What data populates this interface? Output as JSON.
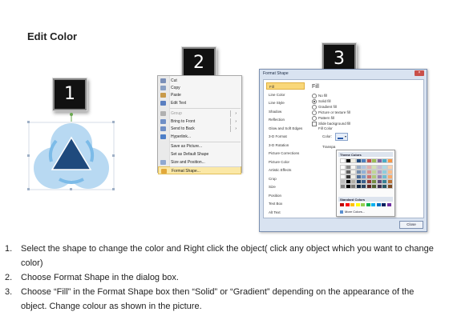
{
  "title": "Edit Color",
  "badges": [
    "1",
    "2",
    "3"
  ],
  "context_menu": {
    "items": [
      {
        "label": "Cut",
        "dim": false,
        "icon": "scissors-icon",
        "color": "#7a8fb8",
        "arrow": false
      },
      {
        "label": "Copy",
        "dim": false,
        "icon": "copy-icon",
        "color": "#8aa0c4",
        "arrow": false
      },
      {
        "label": "Paste",
        "dim": false,
        "icon": "paste-icon",
        "color": "#c89a4a",
        "arrow": false
      },
      {
        "label": "Edit Text",
        "dim": false,
        "icon": "edit-text-icon",
        "color": "#5a7fc0",
        "arrow": false
      },
      {
        "label": "Group",
        "dim": true,
        "icon": "group-icon",
        "color": "#b0b0b0",
        "arrow": true
      },
      {
        "label": "Bring to Front",
        "dim": false,
        "icon": "bring-front-icon",
        "color": "#6f8fc6",
        "arrow": true
      },
      {
        "label": "Send to Back",
        "dim": false,
        "icon": "send-back-icon",
        "color": "#6f8fc6",
        "arrow": true
      },
      {
        "label": "Hyperlink...",
        "dim": false,
        "icon": "hyperlink-icon",
        "color": "#4d7fc8",
        "arrow": false
      },
      {
        "label": "Save as Picture...",
        "dim": false,
        "icon": "",
        "color": "",
        "arrow": false
      },
      {
        "label": "Set as Default Shape",
        "dim": false,
        "icon": "",
        "color": "",
        "arrow": false
      },
      {
        "label": "Size and Position...",
        "dim": false,
        "icon": "size-icon",
        "color": "#8fa8d0",
        "arrow": false
      },
      {
        "label": "Format Shape...",
        "dim": false,
        "icon": "format-shape-icon",
        "color": "#e2a83a",
        "arrow": false
      }
    ]
  },
  "dialog": {
    "title": "Format Shape",
    "nav": [
      "Fill",
      "Line Color",
      "Line Style",
      "Shadow",
      "Reflection",
      "Glow and Soft Edges",
      "3-D Format",
      "3-D Rotation",
      "Picture Corrections",
      "Picture Color",
      "Artistic Effects",
      "Crop",
      "Size",
      "Position",
      "Text Box",
      "Alt Text"
    ],
    "fill_heading": "Fill",
    "options": [
      {
        "label": "No fill",
        "type": "radio",
        "on": false
      },
      {
        "label": "Solid fill",
        "type": "radio",
        "on": true
      },
      {
        "label": "Gradient fill",
        "type": "radio",
        "on": false
      },
      {
        "label": "Picture or texture fill",
        "type": "radio",
        "on": false
      },
      {
        "label": "Pattern fill",
        "type": "radio",
        "on": false
      },
      {
        "label": "Slide background fill",
        "type": "check",
        "on": false
      }
    ],
    "fill_color_label": "Fill Color",
    "color_label": "Color:",
    "transparency_label": "Transpa",
    "theme_colors_label": "Theme Colors",
    "standard_colors_label": "Standard Colors",
    "more_colors_label": "More Colors...",
    "close_label": "Close",
    "theme_top": [
      "#ffffff",
      "#000000",
      "#eeece1",
      "#1f497d",
      "#4f81bd",
      "#c0504d",
      "#9bbb59",
      "#8064a2",
      "#4bacc6",
      "#f79646"
    ],
    "standard": [
      "#c00000",
      "#ff0000",
      "#ffc000",
      "#ffff00",
      "#92d050",
      "#00b050",
      "#00b0f0",
      "#0070c0",
      "#002060",
      "#7030a0"
    ]
  },
  "steps": [
    {
      "num": "1.",
      "text": "Select the shape to change the color and Right click the object( click any object which you want to change color)"
    },
    {
      "num": "2.",
      "text": "Choose Format Shape in the dialog box."
    },
    {
      "num": "3.",
      "text": "Choose “Fill” in the Format Shape box then “Solid” or “Gradient” depending on the appearance of the object. Change colour as shown in the picture."
    }
  ]
}
